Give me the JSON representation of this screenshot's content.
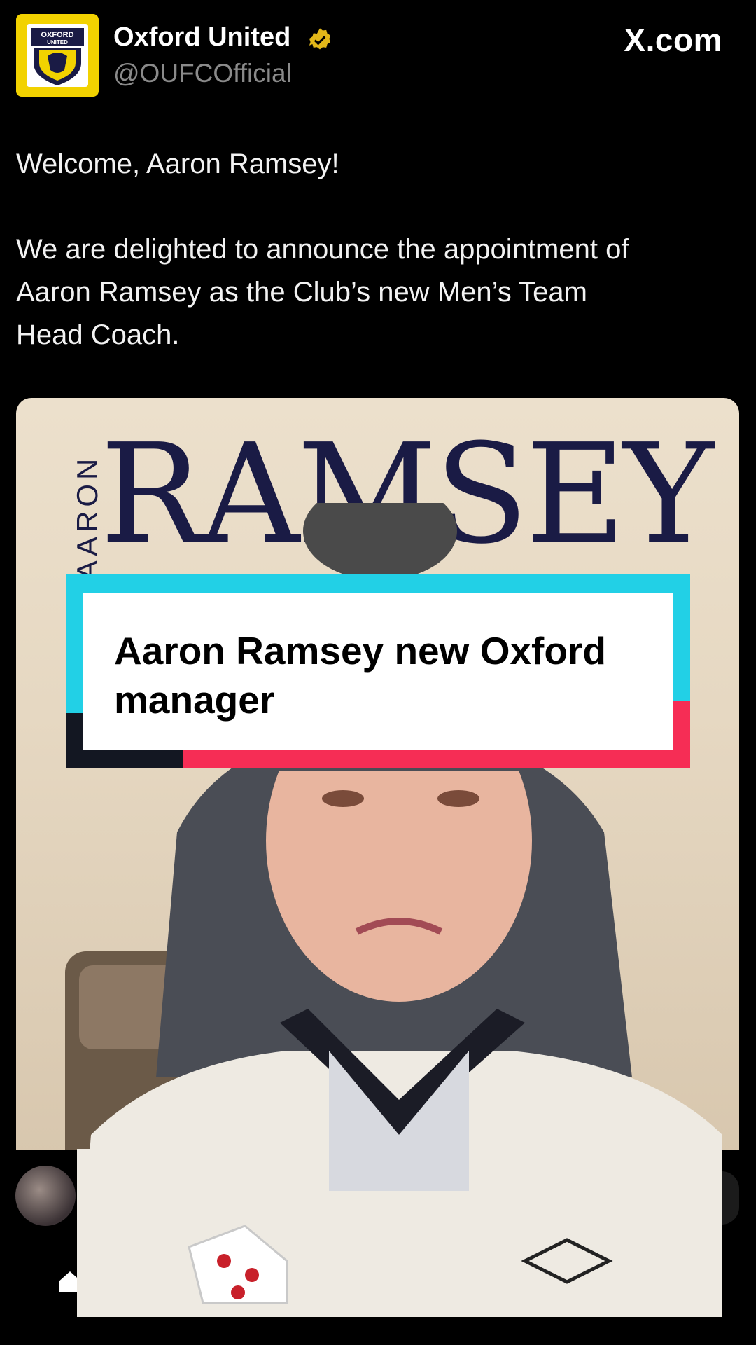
{
  "header": {
    "display_name": "Oxford United",
    "handle": "@OUFCOfficial",
    "site": "X.com",
    "logo_text_top": "OXFORD",
    "logo_text_bottom": "UNITED"
  },
  "tweet": {
    "line1": "Welcome, Aaron Ramsey!",
    "line2": "We are delighted to announce the appointment of",
    "line3": "Aaron Ramsey as the Club’s new Men’s Team",
    "line4": "Head Coach."
  },
  "media": {
    "first_name": "AARON",
    "last_name": "RAMSEY"
  },
  "caption": {
    "text": "Aaron Ramsey new Oxford manager"
  },
  "colors": {
    "brand_yellow": "#f2d200",
    "navy": "#1a1b45",
    "cyan": "#22d0e6",
    "red": "#f62d55"
  },
  "icons": [
    "verified-badge-icon",
    "home-icon"
  ]
}
